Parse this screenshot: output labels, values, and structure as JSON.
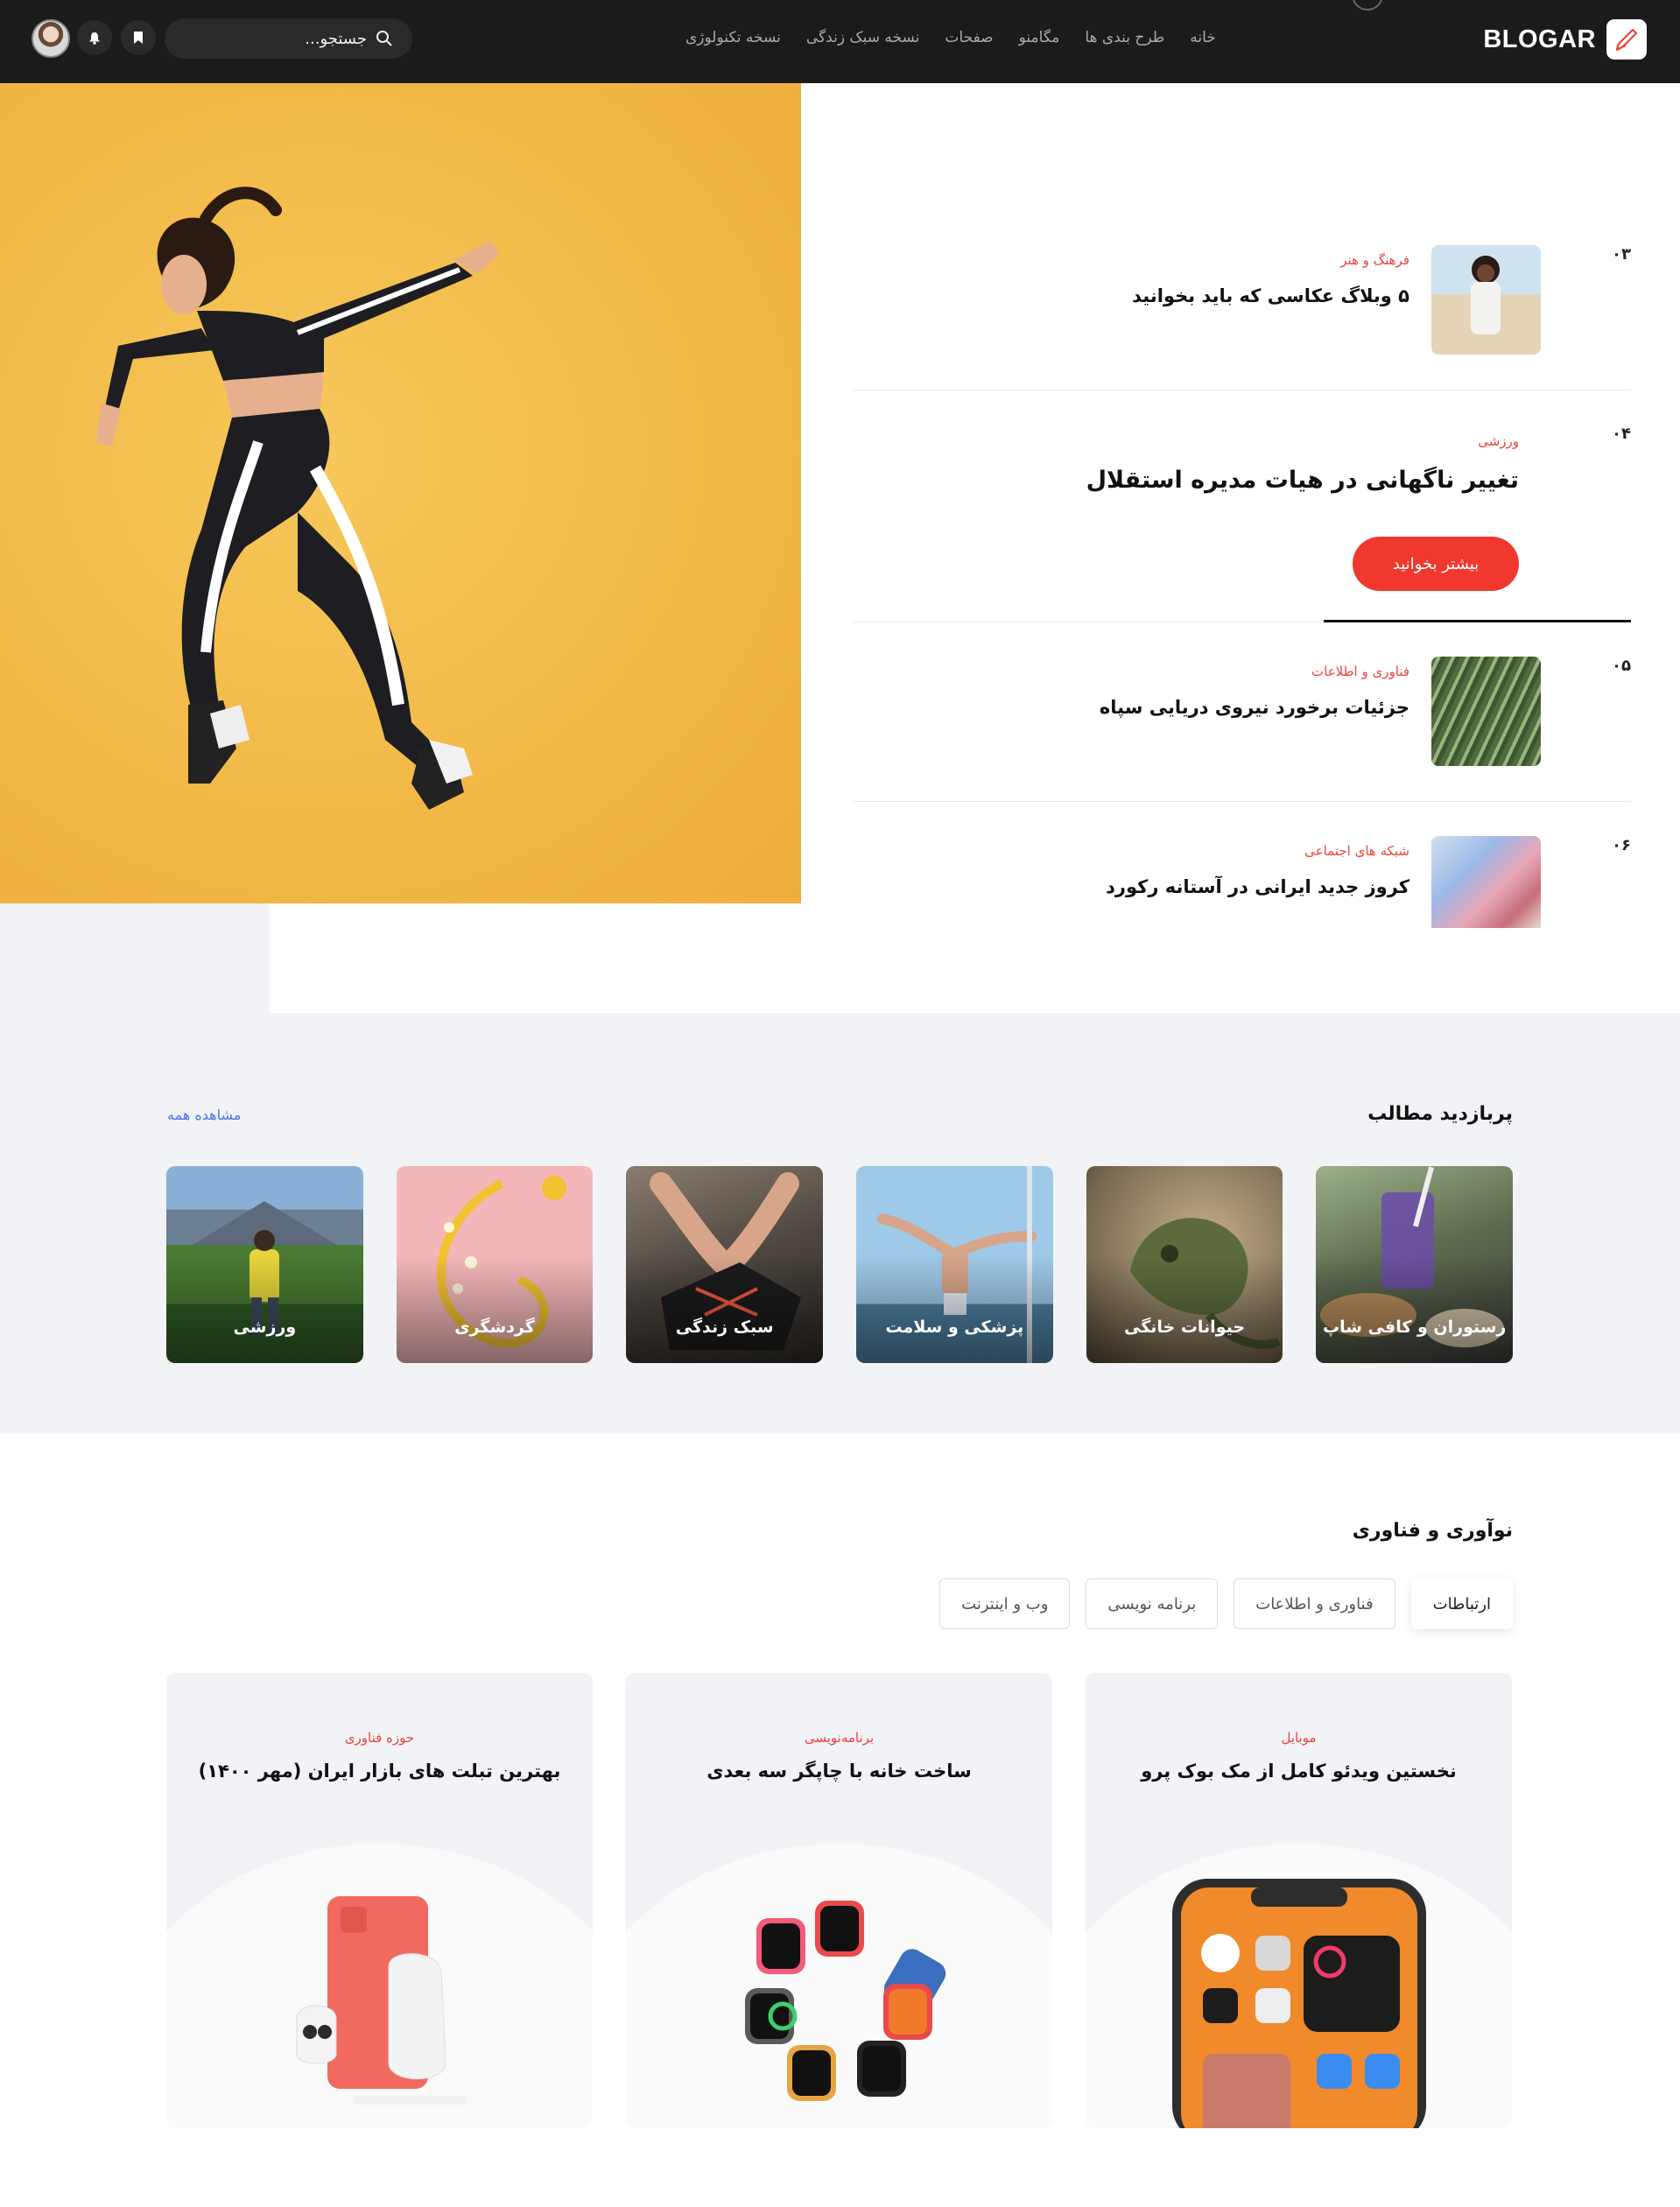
{
  "brand": {
    "name": "BLOGAR"
  },
  "nav": {
    "menu": [
      "خانه",
      "طرح بندی ها",
      "مگامنو",
      "صفحات",
      "نسخه سبک زندگی",
      "نسخه تکنولوژی"
    ],
    "search_placeholder": "جستجو..."
  },
  "hero": {
    "items": [
      {
        "num": "۰۳",
        "category": "فرهنگ و هنر",
        "title": "۵ وبلاگ عکاسی که باید بخوانید"
      },
      {
        "num": "۰۴",
        "category": "ورزشی",
        "title": "تغییر ناگهانی در هیات مدیره استقلال",
        "button": "بیشتر بخوانید"
      },
      {
        "num": "۰۵",
        "category": "فناوری و اطلاعات",
        "title": "جزئیات برخورد نیروی دریایی سپاه"
      },
      {
        "num": "۰۶",
        "category": "شبکه های اجتماعی",
        "title": "کروز جدید ایرانی در آستانه رکورد"
      }
    ]
  },
  "popular": {
    "title": "پربازدید مطالب",
    "view_all": "مشاهده همه",
    "cards": [
      "ورزشی",
      "گردشگری",
      "سبک زندگی",
      "پزشکی و سلامت",
      "حیوانات خانگی",
      "رستوران و کافی شاپ"
    ]
  },
  "tech": {
    "title": "نوآوری و فناوری",
    "tabs": [
      "ارتباطات",
      "فناوری و اطلاعات",
      "برنامه نویسی",
      "وب و اینترنت"
    ],
    "posts": [
      {
        "category": "حوزه فناوری",
        "title": "بهترین تبلت های بازار ایران (مهر ۱۴۰۰)"
      },
      {
        "category": "برنامه‌نویسی",
        "title": "ساخت خانه با چاپگر سه بعدی"
      },
      {
        "category": "موبایل",
        "title": "نخستین ویدئو کامل از مک بوک پرو"
      }
    ]
  },
  "colors": {
    "accent": "#f0382e",
    "link": "#4a73e0",
    "navbar": "#1b1b1b",
    "hero_bg": "#f2b947"
  }
}
